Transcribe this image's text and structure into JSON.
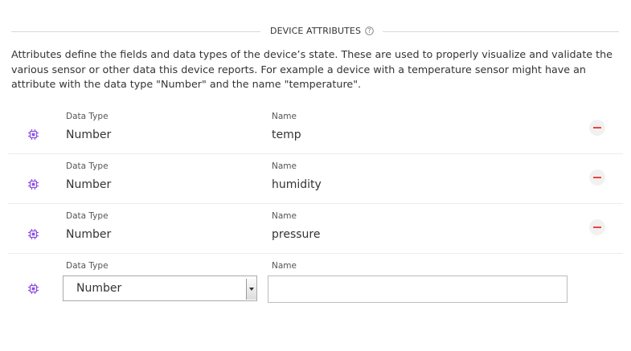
{
  "section": {
    "title": "DEVICE ATTRIBUTES",
    "help_icon": "question-circle-icon"
  },
  "description": "Attributes define the fields and data types of the device’s state. These are used to properly visualize and validate the various sensor or other data this device reports. For example a device with a temperature sensor might have an attribute with the data type \"Number\" and the name \"temperature\".",
  "labels": {
    "data_type": "Data Type",
    "name": "Name"
  },
  "attributes": [
    {
      "data_type": "Number",
      "name": "temp"
    },
    {
      "data_type": "Number",
      "name": "humidity"
    },
    {
      "data_type": "Number",
      "name": "pressure"
    }
  ],
  "new_attribute": {
    "data_type_selected": "Number",
    "name_value": ""
  },
  "icons": {
    "row_icon": "chip-icon",
    "remove_icon": "minus-circle-icon"
  },
  "colors": {
    "icon_purple": "#8a4fe0",
    "remove_red": "#e8453c"
  }
}
